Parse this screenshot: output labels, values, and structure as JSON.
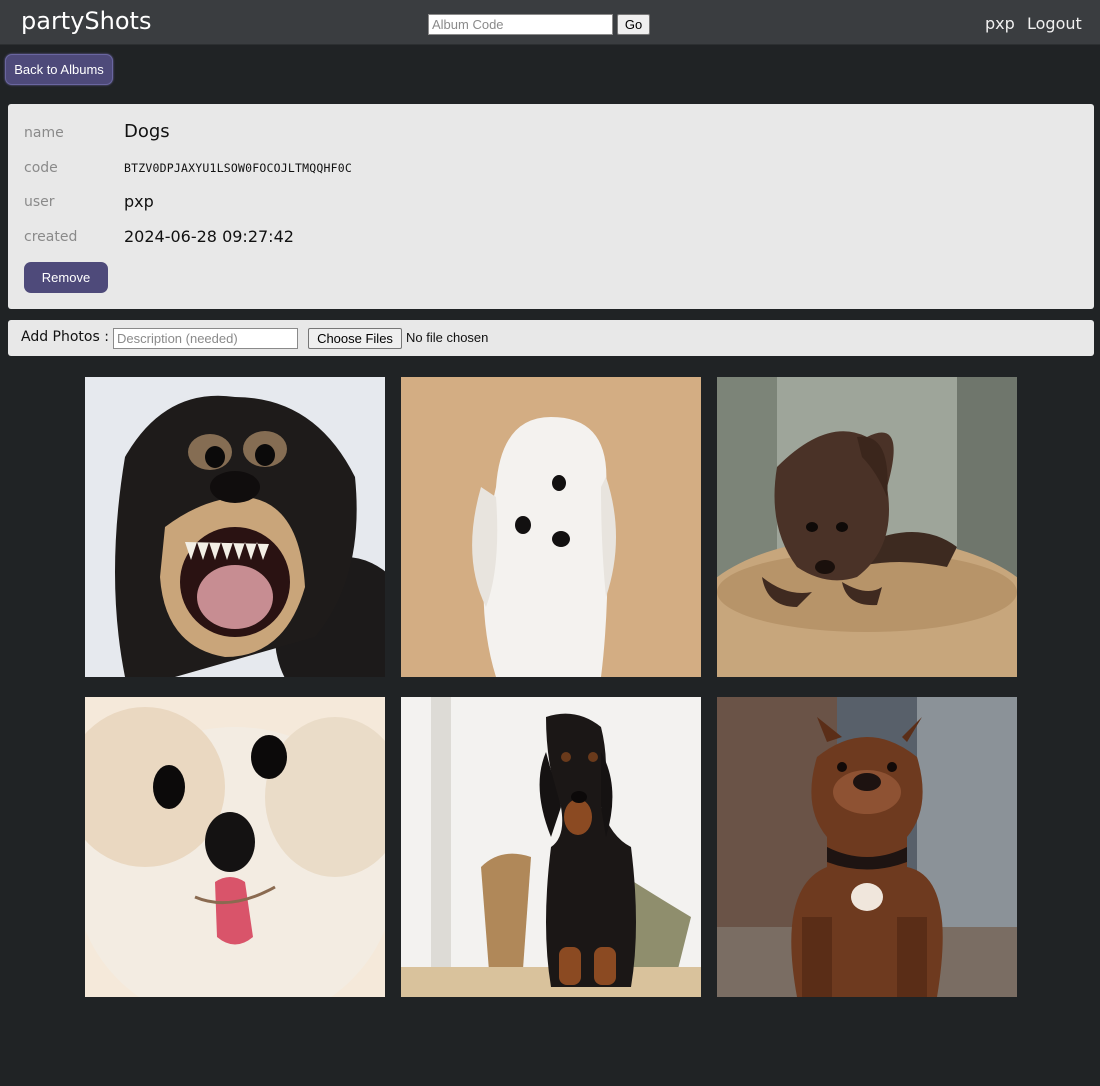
{
  "navbar": {
    "brand": "partyShots",
    "album_code_placeholder": "Album Code",
    "go_label": "Go",
    "user": "pxp",
    "logout_label": "Logout"
  },
  "back_label": "Back to Albums",
  "album": {
    "fields": {
      "name_label": "name",
      "name_value": "Dogs",
      "code_label": "code",
      "code_value": "BTZV0DPJAXYU1LSOW0FOCOJLTMQQHF0C",
      "user_label": "user",
      "user_value": "pxp",
      "created_label": "created",
      "created_value": "2024-06-28 09:27:42"
    },
    "remove_label": "Remove"
  },
  "add_photos": {
    "label": "Add Photos :",
    "description_placeholder": "Description (needed)",
    "choose_label": "Choose Files",
    "no_file_text": "No file chosen"
  },
  "photos": [
    {
      "subject": "snarling black and tan chihuahua"
    },
    {
      "subject": "white maltese head tilt"
    },
    {
      "subject": "chocolate labrador puppy on cushion"
    },
    {
      "subject": "white pomeranian with tongue out"
    },
    {
      "subject": "black and tan dachshund"
    },
    {
      "subject": "brown american bully standing"
    }
  ],
  "colors": {
    "page_bg": "#202325",
    "navbar_bg": "#3a3d40",
    "card_bg": "#e8e8e8",
    "accent_button": "#4e4a7a"
  }
}
